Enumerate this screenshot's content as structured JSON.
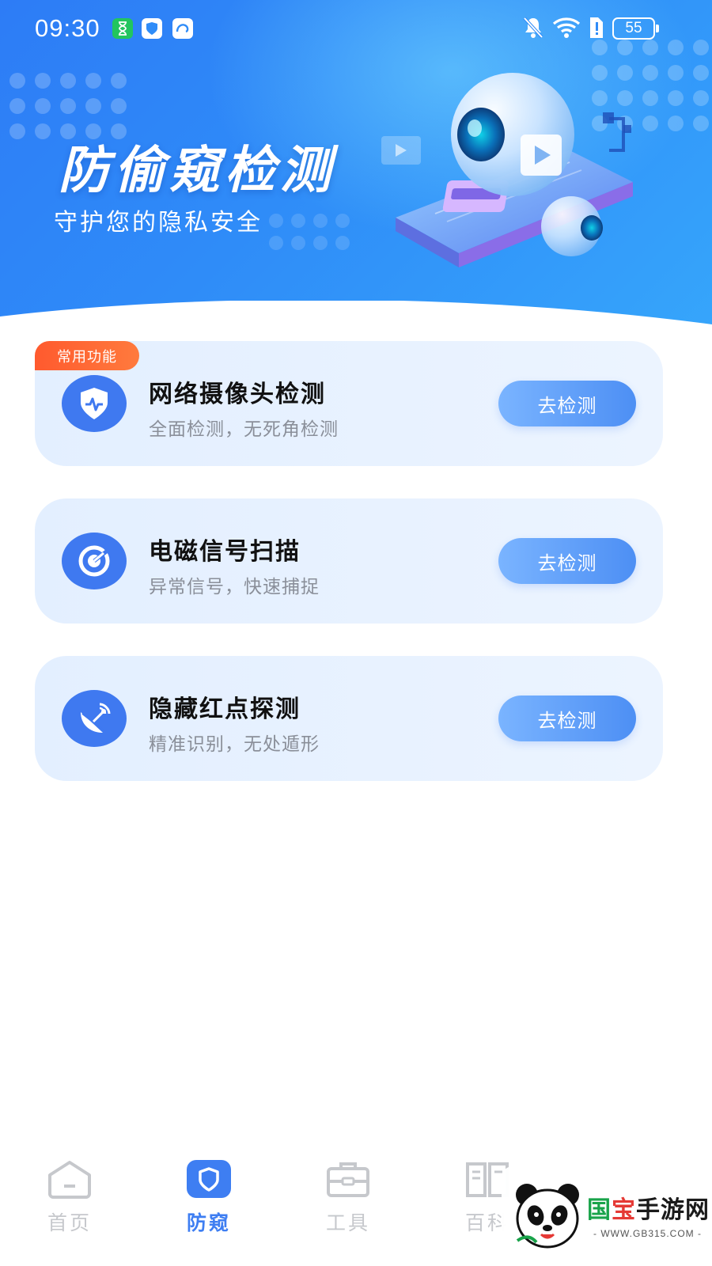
{
  "status_bar": {
    "time": "09:30",
    "battery": "55"
  },
  "hero": {
    "title": "防偷窥检测",
    "subtitle": "守护您的隐私安全"
  },
  "cards": [
    {
      "badge": "常用功能",
      "title": "网络摄像头检测",
      "desc": "全面检测，无死角检测",
      "button": "去检测",
      "icon": "shield-pulse-icon"
    },
    {
      "title": "电磁信号扫描",
      "desc": "异常信号，快速捕捉",
      "button": "去检测",
      "icon": "radar-icon"
    },
    {
      "title": "隐藏红点探测",
      "desc": "精准识别，无处遁形",
      "button": "去检测",
      "icon": "satellite-dish-icon"
    }
  ],
  "bottom_nav": {
    "items": [
      {
        "label": "首页",
        "icon": "home-icon",
        "active": false
      },
      {
        "label": "防窥",
        "icon": "shield-icon",
        "active": true
      },
      {
        "label": "工具",
        "icon": "toolbox-icon",
        "active": false
      },
      {
        "label": "百科",
        "icon": "book-icon",
        "active": false
      }
    ]
  },
  "watermark": {
    "brand_1": "国",
    "brand_2": "宝",
    "brand_3": "手游网",
    "url": "- WWW.GB315.COM -"
  },
  "colors": {
    "primary": "#3e7ef2",
    "badge": "#ff5a2e",
    "card_bg": "#e3efff"
  }
}
